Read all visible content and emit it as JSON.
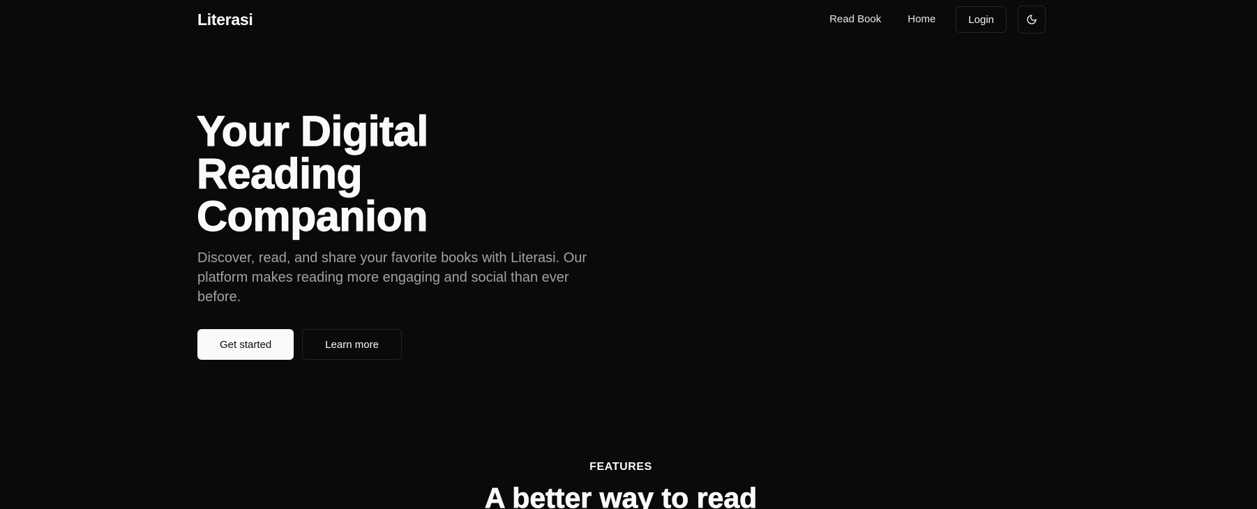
{
  "header": {
    "brand": "Literasi",
    "nav": [
      {
        "label": "Read Book"
      },
      {
        "label": "Home"
      }
    ],
    "login_label": "Login",
    "theme_toggle_icon": "moon-icon"
  },
  "hero": {
    "title_lines": [
      "Your Digital",
      "Reading",
      "Companion"
    ],
    "description": "Discover, read, and share your favorite books with Literasi. Our platform makes reading more engaging and social than ever before.",
    "primary_cta": "Get started",
    "secondary_cta": "Learn more"
  },
  "features": {
    "eyebrow": "FEATURES",
    "title": "A better way to read"
  },
  "colors": {
    "background": "#0a0a0a",
    "foreground": "#fafafa",
    "muted": "#a1a1aa",
    "border": "#262626"
  }
}
